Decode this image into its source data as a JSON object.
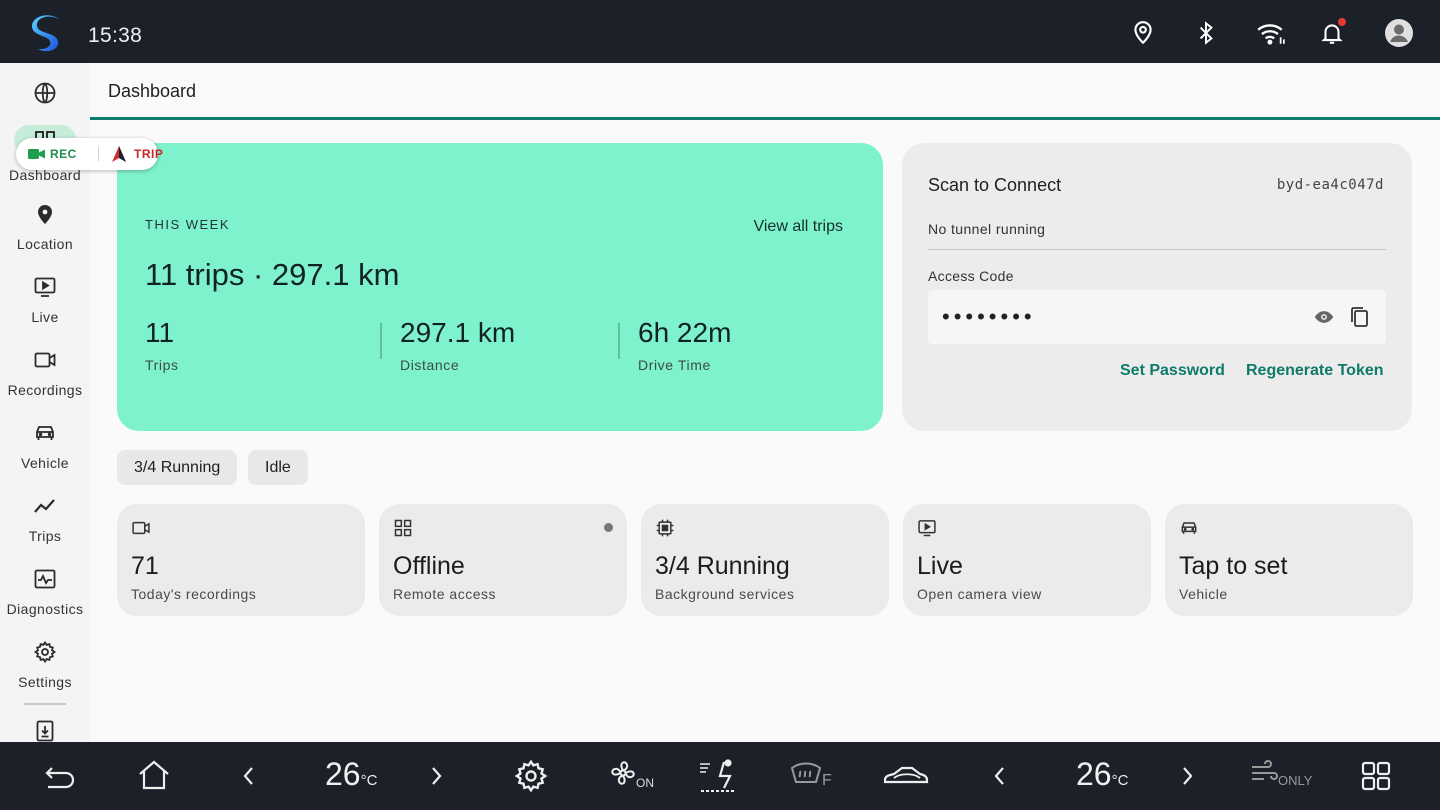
{
  "status_bar": {
    "time": "15:38",
    "icons": [
      "location-icon",
      "bluetooth-icon",
      "wifi-icon",
      "bell-icon",
      "account-icon"
    ],
    "notification_dot_color": "#e53935"
  },
  "nav": {
    "items": [
      {
        "icon": "globe-icon",
        "label": ""
      },
      {
        "icon": "dashboard-icon",
        "label": "Dashboard"
      },
      {
        "icon": "location-pin-icon",
        "label": "Location"
      },
      {
        "icon": "live-play-icon",
        "label": "Live"
      },
      {
        "icon": "video-camera-icon",
        "label": "Recordings"
      },
      {
        "icon": "car-icon",
        "label": "Vehicle"
      },
      {
        "icon": "trend-icon",
        "label": "Trips"
      },
      {
        "icon": "diagnostics-icon",
        "label": "Diagnostics"
      },
      {
        "icon": "gear-icon",
        "label": "Settings"
      },
      {
        "icon": "download-icon",
        "label": ""
      }
    ],
    "active": "Dashboard"
  },
  "indicator_chip": {
    "rec": "REC",
    "trip": "TRIP",
    "rec_color": "#1e8e4a",
    "trip_color": "#c62828"
  },
  "header": {
    "title": "Dashboard",
    "accent_color": "#0d7a6b"
  },
  "week": {
    "label": "THIS WEEK",
    "view_all": "View all trips",
    "summary": "11 trips · 297.1 km",
    "stats": [
      {
        "value": "11",
        "label": "Trips"
      },
      {
        "value": "297.1 km",
        "label": "Distance"
      },
      {
        "value": "6h 22m",
        "label": "Drive Time"
      }
    ],
    "card_color": "#7ef2cd"
  },
  "connect": {
    "title": "Scan to Connect",
    "device_id": "byd-ea4c047d",
    "status": "No tunnel running",
    "access_label": "Access Code",
    "access_value": "••••••••",
    "set_password": "Set Password",
    "regenerate": "Regenerate Token"
  },
  "filters": [
    "3/4 Running",
    "Idle"
  ],
  "tiles": [
    {
      "icon": "video-camera-icon",
      "value": "71",
      "label": "Today's recordings"
    },
    {
      "icon": "dashboard-icon",
      "value": "Offline",
      "label": "Remote access"
    },
    {
      "icon": "chip-icon",
      "value": "3/4 Running",
      "label": "Background services"
    },
    {
      "icon": "live-play-icon",
      "value": "Live",
      "label": "Open camera view"
    },
    {
      "icon": "car-icon",
      "value": "Tap to set",
      "label": "Vehicle"
    }
  ],
  "bottom_bar": {
    "left_temp": "26",
    "right_temp": "26",
    "unit": "°C",
    "fan_label": "ON",
    "defrost_label": "F",
    "only_label": "ONLY"
  }
}
